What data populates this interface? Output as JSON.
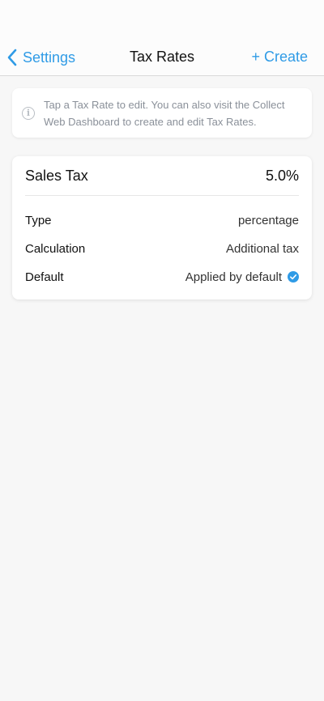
{
  "nav": {
    "back_label": "Settings",
    "title": "Tax Rates",
    "create_label": "+ Create"
  },
  "info": {
    "icon": "info-icon",
    "glyph": "i",
    "text": "Tap a Tax Rate to edit. You can also visit the Collect Web Dashboard to create and edit Tax Rates."
  },
  "tax_rate": {
    "name": "Sales Tax",
    "rate": "5.0%",
    "rows": [
      {
        "label": "Type",
        "value": "percentage"
      },
      {
        "label": "Calculation",
        "value": "Additional tax"
      },
      {
        "label": "Default",
        "value": "Applied by default",
        "icon": "checkmark-circle-icon"
      }
    ]
  },
  "colors": {
    "accent": "#2f9be6",
    "background": "#f7f7f7",
    "card": "#ffffff",
    "muted_text": "#8a9099"
  }
}
